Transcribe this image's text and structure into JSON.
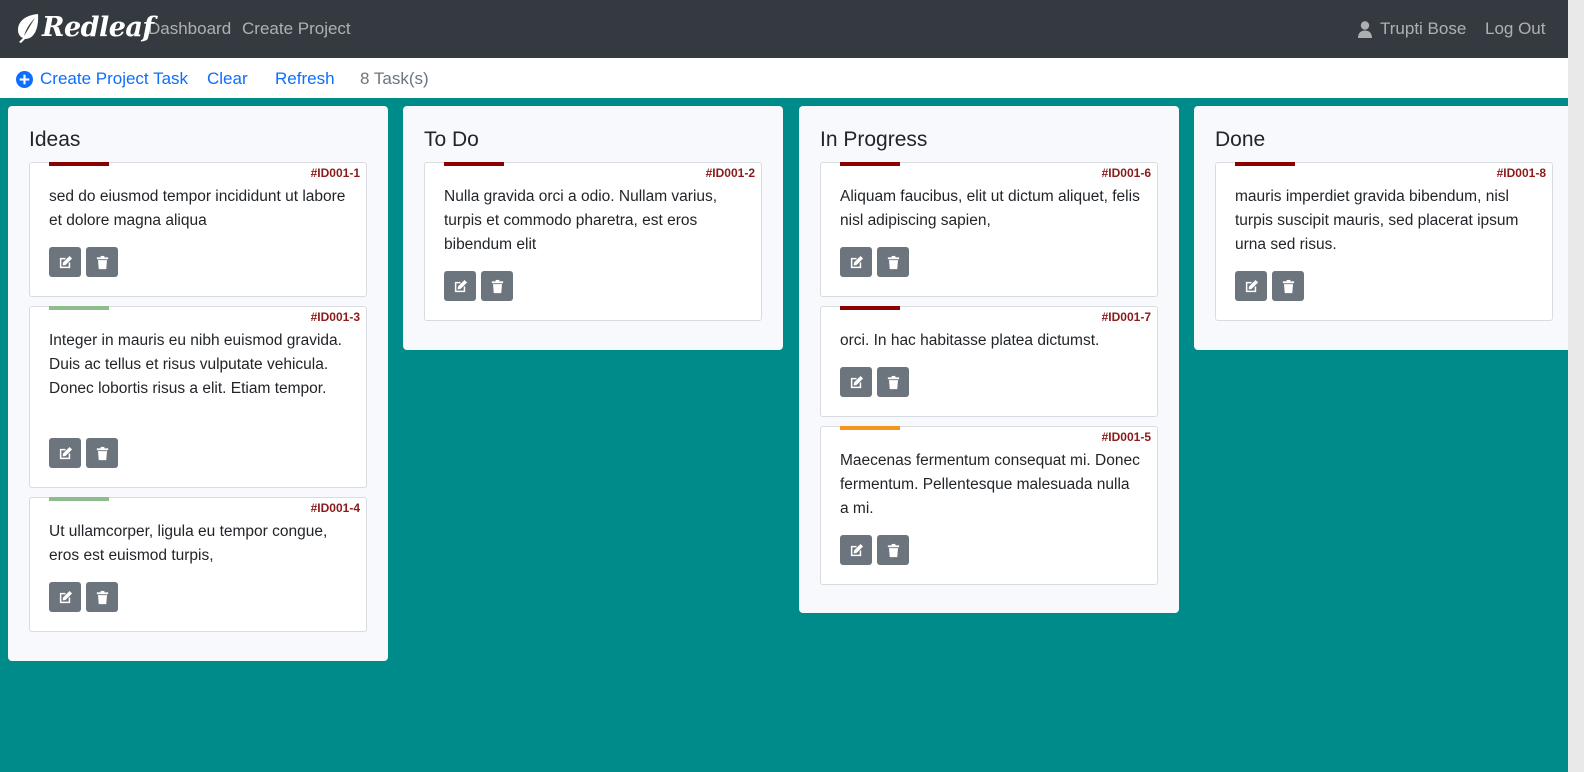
{
  "app": {
    "brand": "Redleaf"
  },
  "navbar": {
    "links": [
      "Dashboard",
      "Create Project"
    ],
    "user_name": "Trupti Bose",
    "logout_label": "Log Out"
  },
  "toolbar": {
    "create_label": "Create Project Task",
    "clear_label": "Clear",
    "refresh_label": "Refresh",
    "task_count": "8 Task(s)"
  },
  "colors": {
    "background": "#008b8b",
    "navbar": "#343a40",
    "link": "#0d6efd",
    "priority_high": "#8b0000",
    "priority_medium": "#f7941d",
    "priority_low": "#8fbc8f",
    "task_id": "#8b1a1a",
    "button": "#6c757d"
  },
  "columns": [
    {
      "title": "Ideas",
      "cards": [
        {
          "id": "#ID001-1",
          "text": "sed do eiusmod tempor incididunt ut labore et dolore magna aliqua",
          "priority": "high"
        },
        {
          "id": "#ID001-3",
          "text": "Integer in mauris eu nibh euismod gravida. Duis ac tellus et risus vulputate vehicula. Donec lobortis risus a elit. Etiam tempor.",
          "priority": "low"
        },
        {
          "id": "#ID001-4",
          "text": "Ut ullamcorper, ligula eu tempor congue, eros est euismod turpis,",
          "priority": "low"
        }
      ]
    },
    {
      "title": "To Do",
      "cards": [
        {
          "id": "#ID001-2",
          "text": "Nulla gravida orci a odio. Nullam varius, turpis et commodo pharetra, est eros bibendum elit",
          "priority": "high"
        }
      ]
    },
    {
      "title": "In Progress",
      "cards": [
        {
          "id": "#ID001-6",
          "text": "Aliquam faucibus, elit ut dictum aliquet, felis nisl adipiscing sapien,",
          "priority": "high"
        },
        {
          "id": "#ID001-7",
          "text": "orci. In hac habitasse platea dictumst.",
          "priority": "high"
        },
        {
          "id": "#ID001-5",
          "text": "Maecenas fermentum consequat mi. Donec fermentum. Pellentesque malesuada nulla a mi.",
          "priority": "medium"
        }
      ]
    },
    {
      "title": "Done",
      "cards": [
        {
          "id": "#ID001-8",
          "text": "mauris imperdiet gravida bibendum, nisl turpis suscipit mauris, sed placerat ipsum urna sed risus.",
          "priority": "high"
        }
      ]
    }
  ],
  "icons": {
    "brand": "leaf-icon",
    "user": "user-icon",
    "create": "plus-circle-icon",
    "edit": "edit-icon",
    "delete": "trash-icon"
  }
}
